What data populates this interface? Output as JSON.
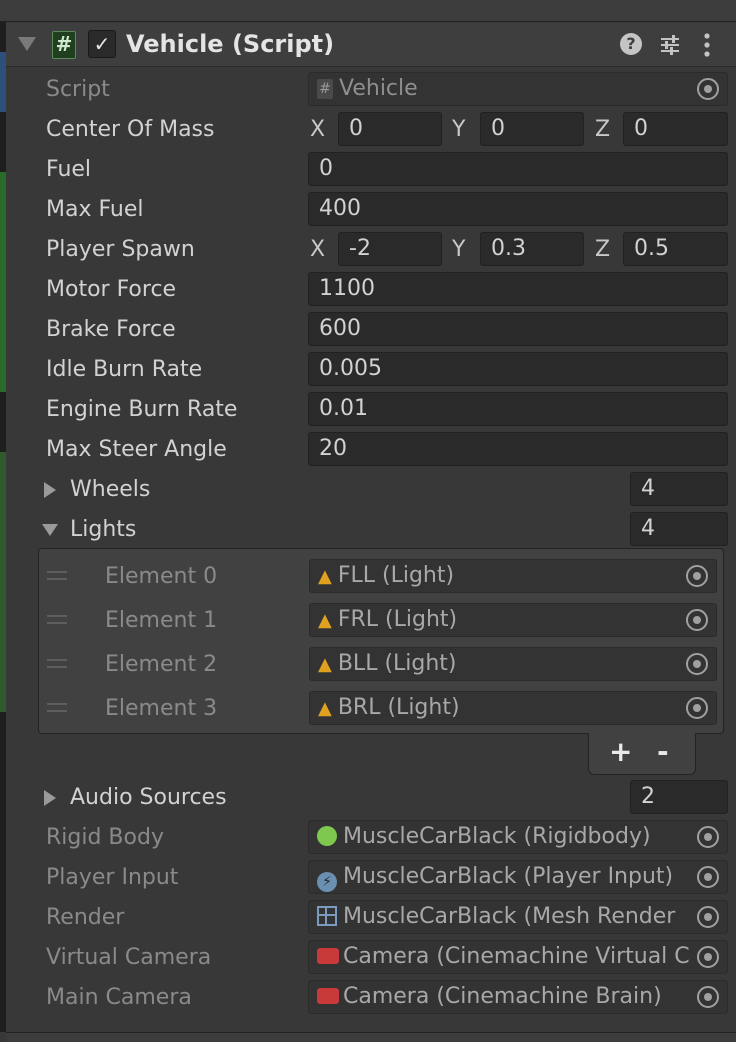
{
  "component": {
    "title": "Vehicle (Script)",
    "enabled": true
  },
  "script": {
    "label": "Script",
    "value": "Vehicle"
  },
  "center_of_mass": {
    "label": "Center Of Mass",
    "x": "0",
    "y": "0",
    "z": "0"
  },
  "fuel": {
    "label": "Fuel",
    "value": "0"
  },
  "max_fuel": {
    "label": "Max Fuel",
    "value": "400"
  },
  "player_spawn": {
    "label": "Player Spawn",
    "x": "-2",
    "y": "0.3",
    "z": "0.5"
  },
  "motor_force": {
    "label": "Motor Force",
    "value": "1100"
  },
  "brake_force": {
    "label": "Brake Force",
    "value": "600"
  },
  "idle_burn_rate": {
    "label": "Idle Burn Rate",
    "value": "0.005"
  },
  "engine_burn_rate": {
    "label": "Engine Burn Rate",
    "value": "0.01"
  },
  "max_steer_angle": {
    "label": "Max Steer Angle",
    "value": "20"
  },
  "axis_labels": {
    "x": "X",
    "y": "Y",
    "z": "Z"
  },
  "wheels": {
    "label": "Wheels",
    "count": "4",
    "expanded": false
  },
  "lights": {
    "label": "Lights",
    "count": "4",
    "expanded": true,
    "elements": [
      {
        "label": "Element 0",
        "value": "FLL (Light)"
      },
      {
        "label": "Element 1",
        "value": "FRL (Light)"
      },
      {
        "label": "Element 2",
        "value": "BLL (Light)"
      },
      {
        "label": "Element 3",
        "value": "BRL (Light)"
      }
    ],
    "add_label": "+",
    "remove_label": "-"
  },
  "audio_sources": {
    "label": "Audio Sources",
    "count": "2",
    "expanded": false
  },
  "rigid_body": {
    "label": "Rigid Body",
    "value": "MuscleCarBlack (Rigidbody)"
  },
  "player_input": {
    "label": "Player Input",
    "value": "MuscleCarBlack (Player Input)"
  },
  "render": {
    "label": "Render",
    "value": "MuscleCarBlack (Mesh Render"
  },
  "virtual_camera": {
    "label": "Virtual Camera",
    "value": "Camera (Cinemachine Virtual C"
  },
  "main_camera": {
    "label": "Main Camera",
    "value": "Camera (Cinemachine Brain)"
  },
  "colors": {
    "background": "#383838",
    "field": "#2a2a2a",
    "text": "#d2d2d2",
    "dim_text": "#8a8a8a",
    "light_icon": "#e0a020",
    "rigidbody_icon": "#7ec850",
    "camera_icon": "#c83a3a"
  }
}
